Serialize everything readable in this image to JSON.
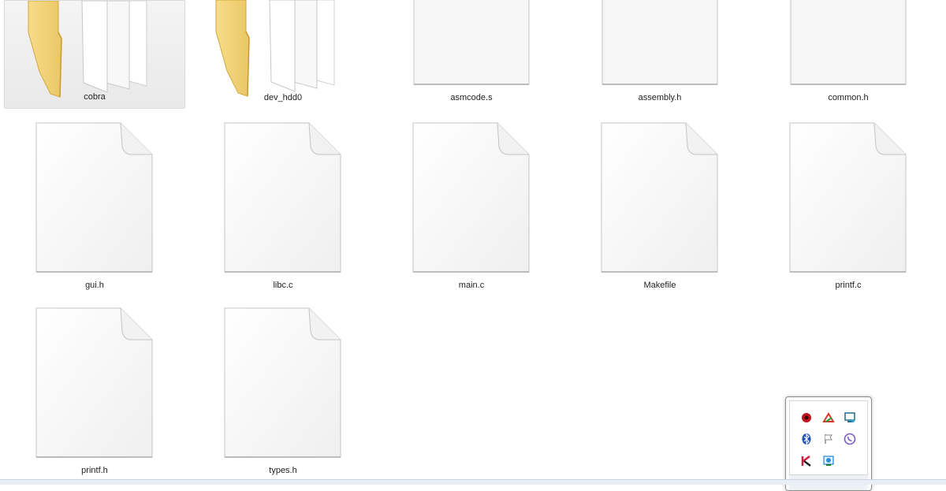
{
  "items": [
    {
      "name": "cobra",
      "type": "folder",
      "selected": true
    },
    {
      "name": "dev_hdd0",
      "type": "folder",
      "selected": false
    },
    {
      "name": "asmcode.s",
      "type": "file",
      "selected": false
    },
    {
      "name": "assembly.h",
      "type": "file",
      "selected": false
    },
    {
      "name": "common.h",
      "type": "file",
      "selected": false
    },
    {
      "name": "gui.h",
      "type": "file",
      "selected": false
    },
    {
      "name": "libc.c",
      "type": "file",
      "selected": false
    },
    {
      "name": "main.c",
      "type": "file",
      "selected": false
    },
    {
      "name": "Makefile",
      "type": "file",
      "selected": false
    },
    {
      "name": "printf.c",
      "type": "file",
      "selected": false
    },
    {
      "name": "printf.h",
      "type": "file",
      "selected": false
    },
    {
      "name": "types.h",
      "type": "file",
      "selected": false
    }
  ],
  "tray": {
    "icons": [
      {
        "icon": "red-app-icon",
        "color": "#c0141e"
      },
      {
        "icon": "autocad-icon",
        "color": "#d33a2c"
      },
      {
        "icon": "monitor-icon",
        "color": "#1f6f8b"
      },
      {
        "icon": "bluetooth-icon",
        "color": "#1e4fb4"
      },
      {
        "icon": "action-center-flag-icon",
        "color": "#8a8a8a"
      },
      {
        "icon": "viber-icon",
        "color": "#7a5bc4"
      },
      {
        "icon": "kaspersky-icon",
        "color": "#d01f3c"
      },
      {
        "icon": "network-icon",
        "color": "#2d8fd6"
      }
    ]
  }
}
